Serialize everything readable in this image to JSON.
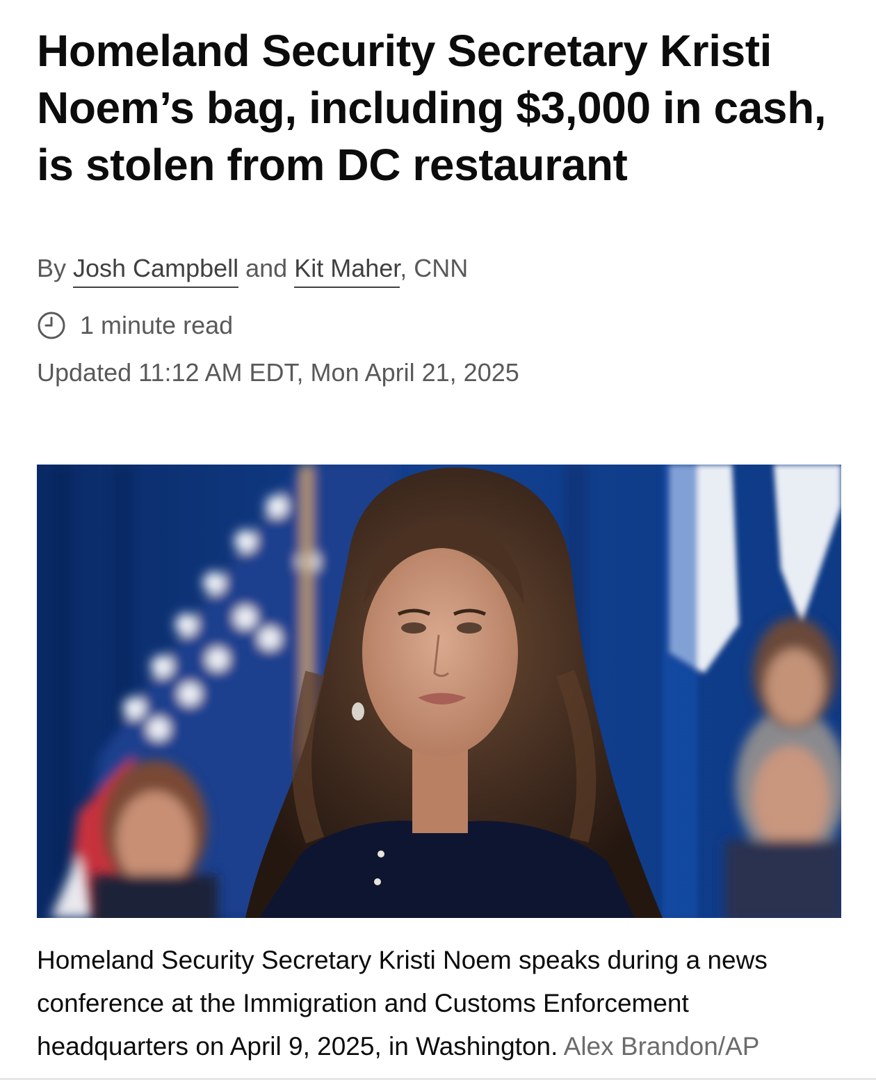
{
  "article": {
    "headline": "Homeland Security Secretary Kristi Noem’s bag, including $3,000 in cash, is stolen from DC restaurant",
    "byline": {
      "prefix": "By ",
      "authors": [
        "Josh Campbell",
        "Kit Maher"
      ],
      "joiner": " and ",
      "suffix": ", CNN"
    },
    "read_time": "1 minute read",
    "updated": "Updated 11:12 AM EDT, Mon April 21, 2025",
    "photo": {
      "caption": "Homeland Security Secretary Kristi Noem speaks during a news conference at the Immigration and Customs Enforcement headquarters on April 9, 2025, in Washington.",
      "credit": "Alex Brandon/AP"
    }
  },
  "icons": {
    "clock": "clock-icon"
  },
  "colors": {
    "text": "#0c0c0c",
    "meta": "#595959",
    "credit": "#6b6b6b"
  }
}
